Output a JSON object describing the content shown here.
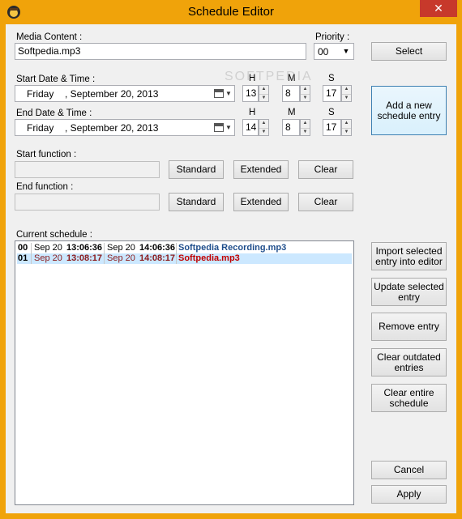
{
  "window": {
    "title": "Schedule Editor",
    "close_glyph": "✕"
  },
  "media": {
    "label": "Media Content :",
    "value": "Softpedia.mp3"
  },
  "priority": {
    "label": "Priority :",
    "value": "00"
  },
  "select_button": "Select",
  "add_button": "Add a new schedule entry",
  "start": {
    "label": "Start Date & Time :",
    "day": "Friday",
    "date": ", September 20, 2013",
    "h_label": "H",
    "m_label": "M",
    "s_label": "S",
    "h": "13",
    "m": "8",
    "s": "17"
  },
  "end": {
    "label": "End Date & Time :",
    "day": "Friday",
    "date": ", September 20, 2013",
    "h_label": "H",
    "m_label": "M",
    "s_label": "S",
    "h": "14",
    "m": "8",
    "s": "17"
  },
  "start_function": {
    "label": "Start function :",
    "value": "",
    "standard": "Standard",
    "extended": "Extended",
    "clear": "Clear"
  },
  "end_function": {
    "label": "End function :",
    "value": "",
    "standard": "Standard",
    "extended": "Extended",
    "clear": "Clear"
  },
  "schedule": {
    "label": "Current schedule :",
    "rows": [
      {
        "id": "00",
        "start_date": "Sep 20",
        "start_time": "13:06:36",
        "end_date": "Sep 20",
        "end_time": "14:06:36",
        "name": "Softpedia Recording.mp3",
        "color": "#1f4e8c"
      },
      {
        "id": "01",
        "start_date": "Sep 20",
        "start_time": "13:08:17",
        "end_date": "Sep 20",
        "end_time": "14:08:17",
        "name": "Softpedia.mp3",
        "color": "#c00000"
      }
    ]
  },
  "side_buttons": {
    "import": "Import selected entry into editor",
    "update": "Update selected entry",
    "remove": "Remove entry",
    "clear_outdated": "Clear outdated entries",
    "clear_entire": "Clear entire schedule",
    "cancel": "Cancel",
    "apply": "Apply"
  },
  "watermark": "SOFTPEDIA",
  "colors": {
    "titlebar": "#f0a30a",
    "close": "#c7392b",
    "selected_row": "#cce8ff"
  }
}
